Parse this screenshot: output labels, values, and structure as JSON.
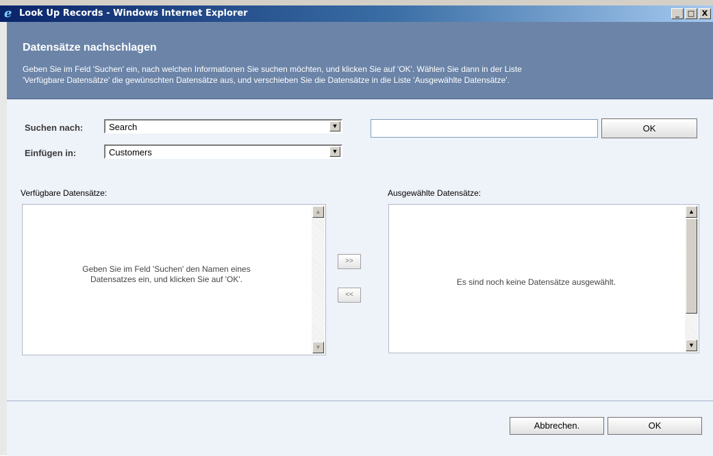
{
  "window": {
    "title": "Look Up Records - Windows Internet Explorer",
    "minimize": "_",
    "maximize": "□",
    "close": "X",
    "icon": "ie-logo-icon"
  },
  "header": {
    "title": "Datensätze nachschlagen",
    "description_line1": "Geben Sie im Feld 'Suchen' ein, nach welchen Informationen Sie suchen möchten, und klicken Sie auf 'OK'. Wählen Sie dann in der Liste",
    "description_line2": "'Verfügbare Datensätze' die gewünschten Datensätze aus, und verschieben Sie die Datensätze in die Liste 'Ausgewählte Datensätze'."
  },
  "form": {
    "search_by_label": "Suchen nach:",
    "search_by_value": "Search",
    "insert_in_label": "Einfügen in:",
    "insert_in_value": "Customers",
    "search_text_value": "",
    "ok_label": "OK"
  },
  "available": {
    "label": "Verfügbare Datensätze:",
    "empty_line1": "Geben Sie im Feld 'Suchen' den Namen eines",
    "empty_line2": "Datensatzes ein, und klicken Sie auf 'OK'."
  },
  "move": {
    "add": ">>",
    "remove": "<<"
  },
  "selected": {
    "label": "Ausgewählte Datensätze:",
    "empty": "Es sind noch keine Datensätze ausgewählt."
  },
  "footer": {
    "cancel_label": "Abbrechen.",
    "ok_label": "OK"
  },
  "colors": {
    "header_bg": "#6b84a8",
    "content_bg": "#eef2f9",
    "titlebar_start": "#0a246a"
  }
}
